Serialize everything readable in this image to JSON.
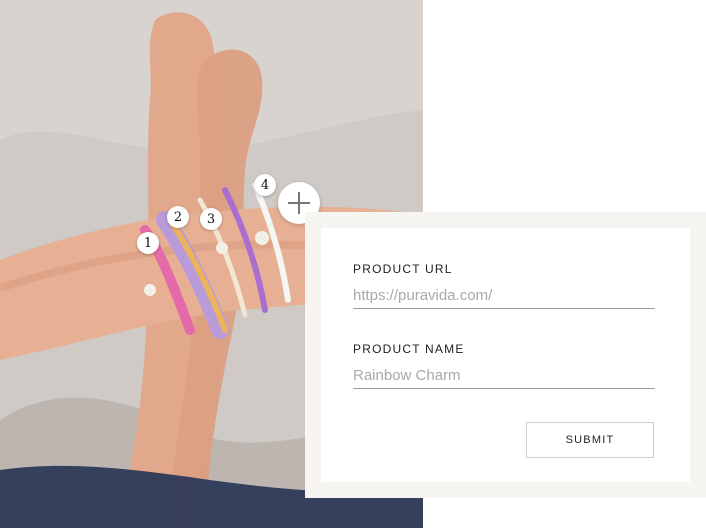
{
  "hotspots": [
    {
      "label": "1"
    },
    {
      "label": "2"
    },
    {
      "label": "3"
    },
    {
      "label": "4"
    }
  ],
  "form": {
    "product_url": {
      "label": "PRODUCT URL",
      "placeholder": "https://puravida.com/"
    },
    "product_name": {
      "label": "PRODUCT NAME",
      "placeholder": "Rainbow Charm"
    },
    "submit_label": "SUBMIT"
  },
  "colors": {
    "panel_outer": "#f7f5f2",
    "panel_inner": "#ffffff",
    "label_text": "#222222",
    "input_underline": "#9a9a9a",
    "placeholder_text": "#a9a9a9"
  }
}
